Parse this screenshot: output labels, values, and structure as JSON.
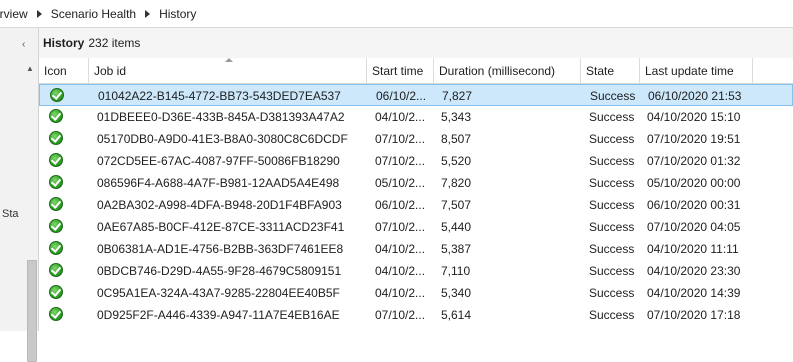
{
  "breadcrumb": [
    "erview",
    "Scenario Health",
    "History"
  ],
  "leftnav": {
    "collapse_glyph": "‹",
    "label": "Sta"
  },
  "panel": {
    "title": "History",
    "count_text": "232 items"
  },
  "columns": [
    "Icon",
    "Job id",
    "Start time",
    "Duration (millisecond)",
    "State",
    "Last update time"
  ],
  "rows": [
    {
      "job": "01042A22-B145-4772-BB73-543DED7EA537",
      "start": "06/10/2...",
      "duration": "7,827",
      "state": "Success",
      "updated": "06/10/2020 21:53"
    },
    {
      "job": "01DBEEE0-D36E-433B-845A-D381393A47A2",
      "start": "04/10/2...",
      "duration": "5,343",
      "state": "Success",
      "updated": "04/10/2020 15:10"
    },
    {
      "job": "05170DB0-A9D0-41E3-B8A0-3080C8C6DCDF",
      "start": "07/10/2...",
      "duration": "8,507",
      "state": "Success",
      "updated": "07/10/2020 19:51"
    },
    {
      "job": "072CD5EE-67AC-4087-97FF-50086FB18290",
      "start": "07/10/2...",
      "duration": "5,520",
      "state": "Success",
      "updated": "07/10/2020 01:32"
    },
    {
      "job": "086596F4-A688-4A7F-B981-12AAD5A4E498",
      "start": "05/10/2...",
      "duration": "7,820",
      "state": "Success",
      "updated": "05/10/2020 00:00"
    },
    {
      "job": "0A2BA302-A998-4DFA-B948-20D1F4BFA903",
      "start": "06/10/2...",
      "duration": "7,507",
      "state": "Success",
      "updated": "06/10/2020 00:31"
    },
    {
      "job": "0AE67A85-B0CF-412E-87CE-3311ACD23F41",
      "start": "07/10/2...",
      "duration": "5,440",
      "state": "Success",
      "updated": "07/10/2020 04:05"
    },
    {
      "job": "0B06381A-AD1E-4756-B2BB-363DF7461EE8",
      "start": "04/10/2...",
      "duration": "5,387",
      "state": "Success",
      "updated": "04/10/2020 11:11"
    },
    {
      "job": "0BDCB746-D29D-4A55-9F28-4679C5809151",
      "start": "04/10/2...",
      "duration": "7,110",
      "state": "Success",
      "updated": "04/10/2020 23:30"
    },
    {
      "job": "0C95A1EA-324A-43A7-9285-22804EE40B5F",
      "start": "04/10/2...",
      "duration": "5,340",
      "state": "Success",
      "updated": "04/10/2020 14:39"
    },
    {
      "job": "0D925F2F-A446-4339-A947-11A7E4EB16AE",
      "start": "07/10/2...",
      "duration": "5,614",
      "state": "Success",
      "updated": "07/10/2020 17:18"
    }
  ],
  "selected_row": 0,
  "colors": {
    "selection_bg": "#cde8fb",
    "selection_border": "#84c2ee",
    "success_icon": "#2f9e27"
  }
}
